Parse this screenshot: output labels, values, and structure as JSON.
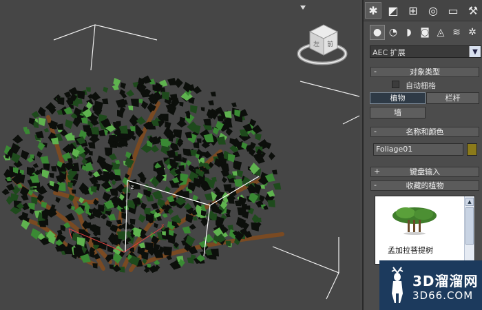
{
  "command_panel": {
    "tabs": [
      {
        "icon": "create-icon",
        "glyph": "✱",
        "active": true
      },
      {
        "icon": "modify-icon",
        "glyph": "◩",
        "active": false
      },
      {
        "icon": "hierarchy-icon",
        "glyph": "⊞",
        "active": false
      },
      {
        "icon": "motion-icon",
        "glyph": "◎",
        "active": false
      },
      {
        "icon": "display-icon",
        "glyph": "▭",
        "active": false
      },
      {
        "icon": "utilities-icon",
        "glyph": "⚒",
        "active": false
      }
    ],
    "subcategories": [
      {
        "icon": "geometry-icon",
        "glyph": "●",
        "active": true
      },
      {
        "icon": "shapes-icon",
        "glyph": "◔",
        "active": false
      },
      {
        "icon": "lights-icon",
        "glyph": "◗",
        "active": false
      },
      {
        "icon": "cameras-icon",
        "glyph": "◙",
        "active": false
      },
      {
        "icon": "helpers-icon",
        "glyph": "◬",
        "active": false
      },
      {
        "icon": "spacewarps-icon",
        "glyph": "≋",
        "active": false
      },
      {
        "icon": "systems-icon",
        "glyph": "✲",
        "active": false
      }
    ],
    "category_dropdown": "AEC 扩展",
    "object_type": {
      "title": "对象类型",
      "collapse_sign": "-",
      "autogrid_label": "自动栅格",
      "buttons": [
        "植物",
        "栏杆",
        "墙"
      ]
    },
    "name_color": {
      "title": "名称和颜色",
      "collapse_sign": "-",
      "name_value": "Foliage01",
      "color": "#8b7a1a"
    },
    "keyboard_entry": {
      "title": "键盘输入",
      "collapse_sign": "+"
    },
    "favorite_plants": {
      "title": "收藏的植物",
      "collapse_sign": "-",
      "items": [
        "孟加拉菩提树"
      ]
    }
  },
  "viewcube": {
    "face_left": "左",
    "face_front": "前"
  },
  "watermark": {
    "line1": "3D溜溜网",
    "line2": "3D66.COM"
  }
}
